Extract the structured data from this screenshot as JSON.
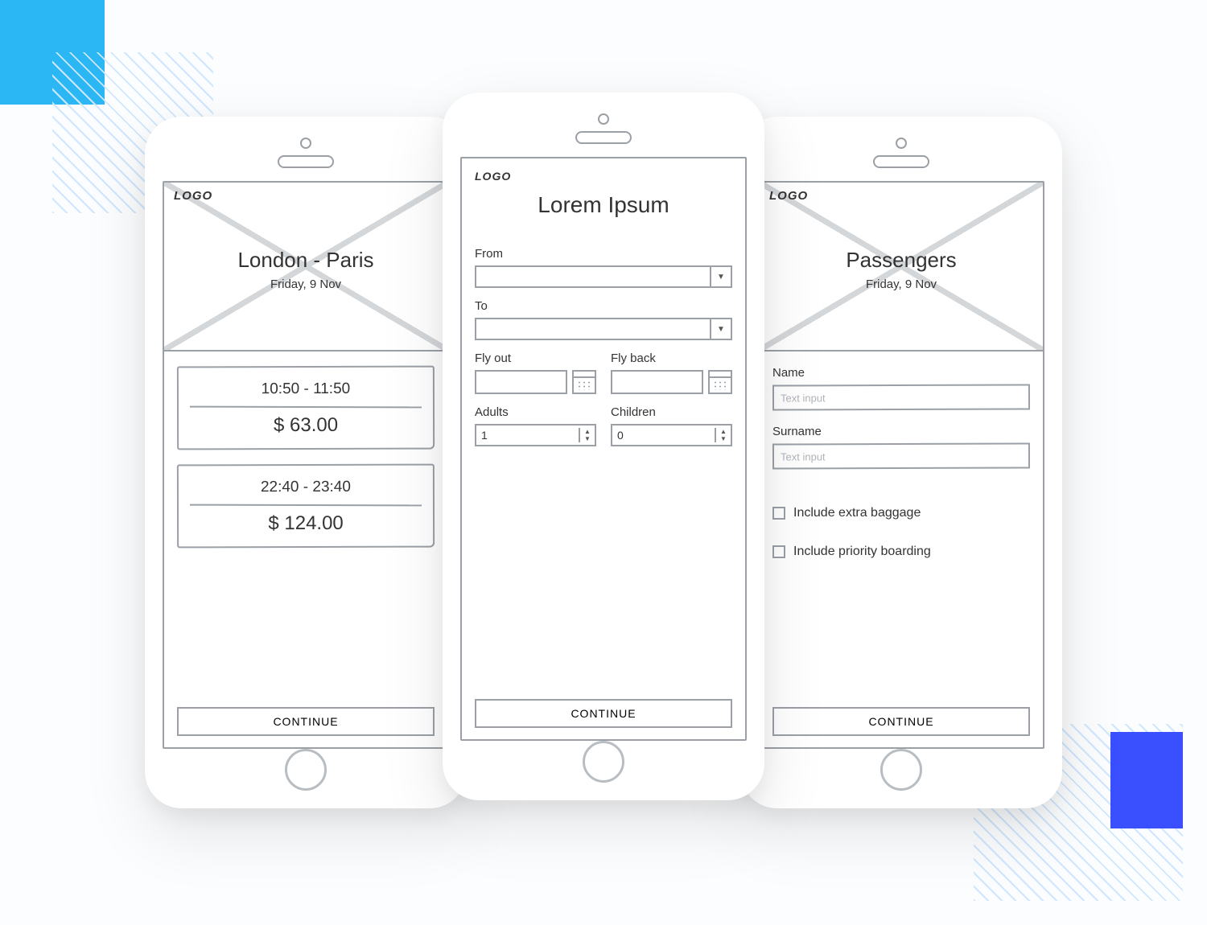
{
  "common": {
    "logo": "LOGO",
    "continue": "CONTINUE"
  },
  "results": {
    "title": "London - Paris",
    "subtitle": "Friday, 9 Nov",
    "flights": [
      {
        "times": "10:50 - 11:50",
        "price": "$ 63.00"
      },
      {
        "times": "22:40 - 23:40",
        "price": "$ 124.00"
      }
    ]
  },
  "search": {
    "title": "Lorem Ipsum",
    "from_label": "From",
    "to_label": "To",
    "flyout_label": "Fly out",
    "flyback_label": "Fly back",
    "adults_label": "Adults",
    "children_label": "Children",
    "adults_value": "1",
    "children_value": "0"
  },
  "passengers": {
    "title": "Passengers",
    "subtitle": "Friday, 9 Nov",
    "name_label": "Name",
    "surname_label": "Surname",
    "placeholder": "Text input",
    "extra_baggage": "Include extra baggage",
    "priority_boarding": "Include priority boarding"
  }
}
